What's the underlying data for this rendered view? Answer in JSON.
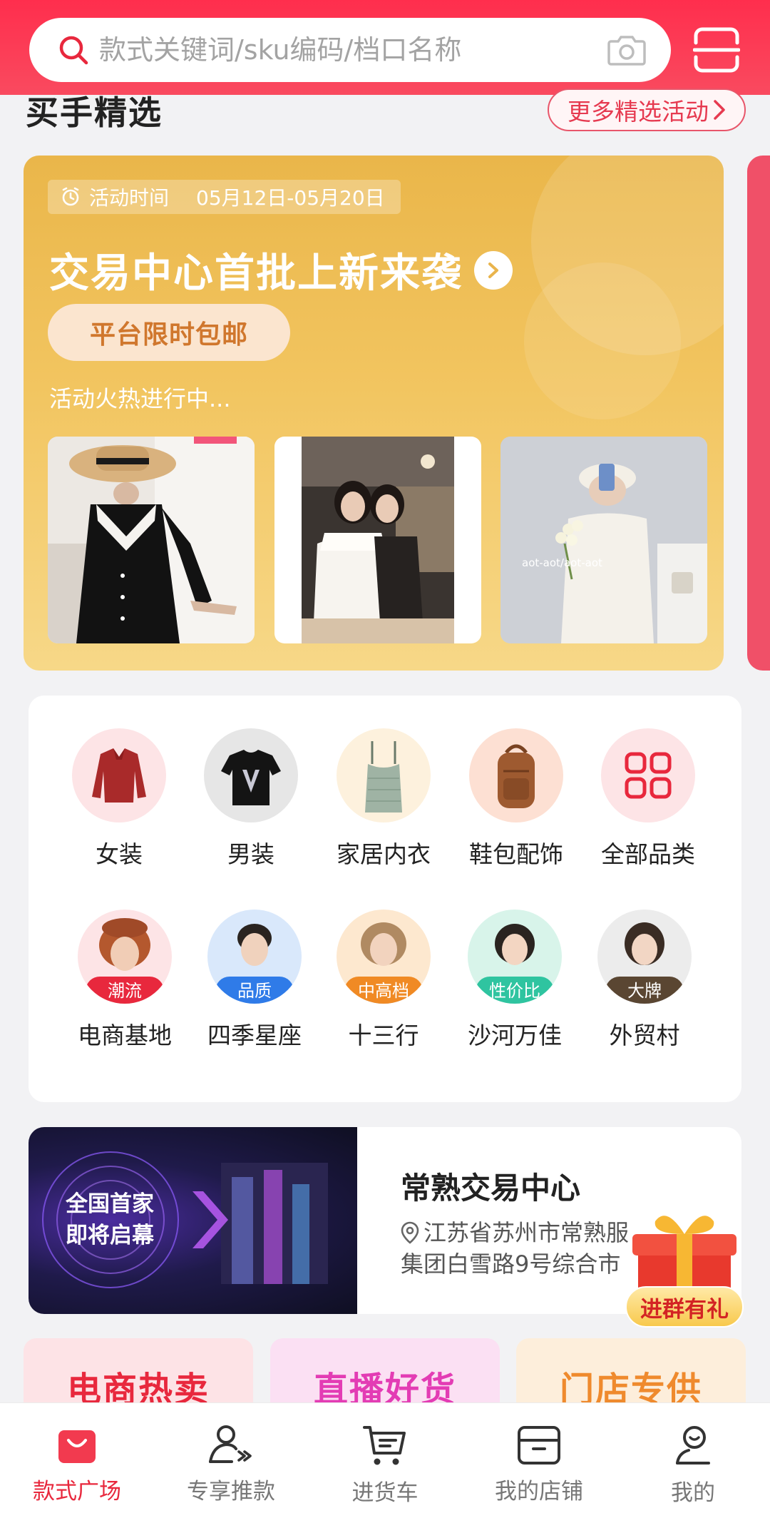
{
  "colors": {
    "brand": "#f8314f",
    "activity_gold": "#efc055",
    "tag_red": "#e8283d"
  },
  "search": {
    "placeholder": "款式关键词/sku编码/档口名称"
  },
  "section": {
    "title": "买手精选",
    "more_label": "更多精选活动"
  },
  "activity": {
    "time_label": "活动时间",
    "time_range": "05月12日-05月20日",
    "title": "交易中心首批上新来袭",
    "badge": "平台限时包邮",
    "subtitle": "活动火热进行中...",
    "photo_caption_3": "aot-aot/aot-aot"
  },
  "categories": [
    {
      "label": "女装",
      "icon": "red-shirt-icon"
    },
    {
      "label": "男装",
      "icon": "tshirt-icon"
    },
    {
      "label": "家居内衣",
      "icon": "camisole-icon"
    },
    {
      "label": "鞋包配饰",
      "icon": "backpack-icon"
    },
    {
      "label": "全部品类",
      "icon": "grid-icon"
    }
  ],
  "markets": [
    {
      "label": "电商基地",
      "tag": "潮流",
      "tag_color": "#e8283d"
    },
    {
      "label": "四季星座",
      "tag": "品质",
      "tag_color": "#2f7be8"
    },
    {
      "label": "十三行",
      "tag": "中高档",
      "tag_color": "#f08a24"
    },
    {
      "label": "沙河万佳",
      "tag": "性价比",
      "tag_color": "#2fc4a0"
    },
    {
      "label": "外贸村",
      "tag": "大牌",
      "tag_color": "#5a4632"
    }
  ],
  "trade": {
    "banner_line1": "全国首家",
    "banner_line2": "即将启幕",
    "title": "常熟交易中心",
    "address_line1": "江苏省苏州市常熟服",
    "address_line2": "集团白雪路9号综合市",
    "gift_label": "进群有礼"
  },
  "promos": [
    "电商热卖",
    "直播好货",
    "门店专供"
  ],
  "tabs": [
    {
      "label": "款式广场",
      "icon": "shopping-bag-icon",
      "active": true
    },
    {
      "label": "专享推款",
      "icon": "person-star-icon",
      "active": false
    },
    {
      "label": "进货车",
      "icon": "cart-icon",
      "active": false
    },
    {
      "label": "我的店铺",
      "icon": "store-icon",
      "active": false
    },
    {
      "label": "我的",
      "icon": "profile-icon",
      "active": false
    }
  ]
}
